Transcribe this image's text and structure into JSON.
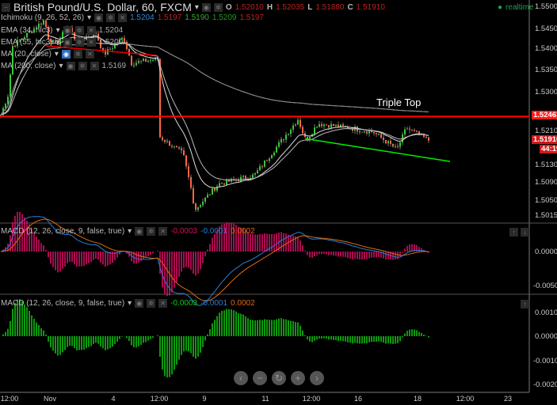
{
  "header": {
    "symbol": "British Pound/U.S. Dollar, 60, FXCM",
    "ohlc": {
      "o_label": "O",
      "o": "1.52010",
      "h_label": "H",
      "h": "1.52035",
      "l_label": "L",
      "l": "1.51880",
      "c_label": "C",
      "c": "1.51910"
    },
    "status": "realtime"
  },
  "indicators": [
    {
      "name": "Ichimoku (9, 26, 52, 26)",
      "values": [
        "1.5204",
        "1.5197",
        "1.5190",
        "1.5209",
        "1.5197"
      ]
    },
    {
      "name": "EMA (34, hlc3)",
      "values": [
        "1.5204"
      ]
    },
    {
      "name": "EMA (55, hlc3)",
      "values": [
        "1.5200"
      ]
    },
    {
      "name": "MA (20, close)",
      "values": []
    },
    {
      "name": "MA (200, close)",
      "values": [
        "1.5169"
      ]
    }
  ],
  "annotation": "Triple Top",
  "price_axis": [
    "1.55000",
    "1.54500",
    "1.54000",
    "1.53500",
    "1.53000",
    "1.52100",
    "1.51300",
    "1.50900",
    "1.50500",
    "1.50150"
  ],
  "price_tags": {
    "resistance": "1.52463",
    "last": "1.51910",
    "countdown": "44:19"
  },
  "macd1": {
    "name": "MACD (12, 26, close, 9, false, true)",
    "values": [
      "-0.0003",
      "-0.0001",
      "0.0002"
    ],
    "axis": [
      "0.0000",
      "-0.0050"
    ]
  },
  "macd2": {
    "name": "MACD (12, 26, close, 9, false, true)",
    "values": [
      "-0.0003",
      "-0.0001",
      "0.0002"
    ],
    "axis": [
      "0.0010",
      "0.0000",
      "-0.0010",
      "-0.0020"
    ]
  },
  "time_axis": [
    "12:00",
    "Nov",
    "4",
    "12:00",
    "9",
    "11",
    "12:00",
    "16",
    "18",
    "12:00",
    "23"
  ],
  "nav": {
    "left": "‹",
    "zoom_out": "−",
    "reset": "↻",
    "zoom_in": "+",
    "right": "›"
  },
  "colors": {
    "up": "#33cc33",
    "down": "#ff6644",
    "resistance": "#ff0000",
    "support": "#00ee00",
    "macd_line": "#2a7fd4",
    "signal_line": "#e06a10",
    "hist1": "#e0106a",
    "hist2": "#11cc11"
  },
  "chart_data": {
    "type": "candlestick",
    "ylim": [
      1.5005,
      1.5515
    ],
    "close_path": [
      [
        0,
        1.525
      ],
      [
        10,
        1.53
      ],
      [
        15,
        1.541
      ],
      [
        55,
        1.547
      ],
      [
        60,
        1.543
      ],
      [
        70,
        1.541
      ],
      [
        85,
        1.546
      ],
      [
        95,
        1.542
      ],
      [
        120,
        1.544
      ],
      [
        130,
        1.539
      ],
      [
        155,
        1.543
      ],
      [
        165,
        1.537
      ],
      [
        198,
        1.538
      ],
      [
        200,
        1.52
      ],
      [
        230,
        1.516
      ],
      [
        240,
        1.508
      ],
      [
        245,
        1.503
      ],
      [
        275,
        1.509
      ],
      [
        320,
        1.511
      ],
      [
        350,
        1.518
      ],
      [
        375,
        1.524
      ],
      [
        385,
        1.519
      ],
      [
        400,
        1.523
      ],
      [
        440,
        1.522
      ],
      [
        470,
        1.521
      ],
      [
        500,
        1.517
      ],
      [
        512,
        1.522
      ],
      [
        540,
        1.5191
      ]
    ],
    "resistance": 1.52463,
    "support_line": [
      [
        1.5195
      ],
      [
        1.5142
      ]
    ]
  }
}
